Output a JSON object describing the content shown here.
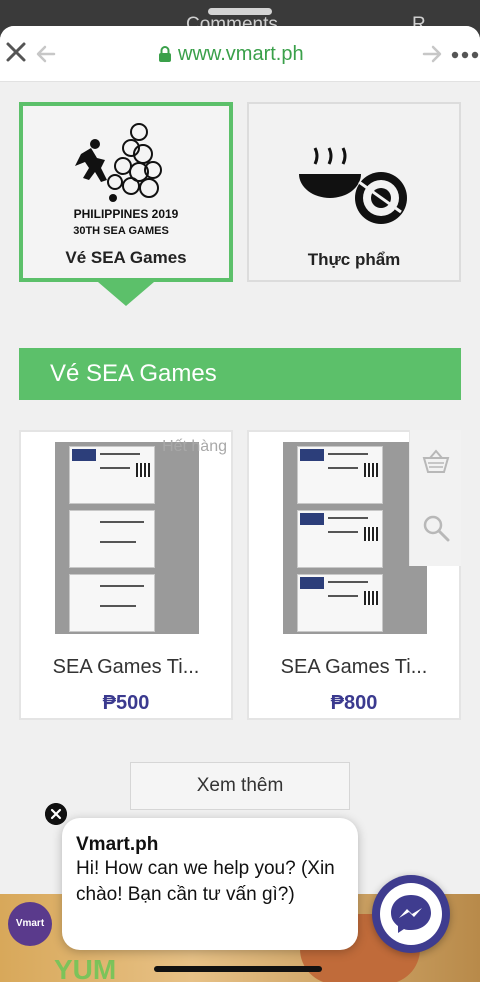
{
  "behind_sheet": {
    "peek_left": "Comments",
    "peek_right": "R"
  },
  "browser": {
    "url": "www.vmart.ph"
  },
  "categories": [
    {
      "label": "Vé SEA Games",
      "logo_text_1": "PHILIPPINES 2019",
      "logo_text_2": "30TH SEA GAMES"
    },
    {
      "label": "Thực phẩm"
    }
  ],
  "section": {
    "title": "Vé SEA Games"
  },
  "products": [
    {
      "title": "SEA Games Ti...",
      "price": "₱500",
      "badge": "Hết hàng"
    },
    {
      "title": "SEA Games Ti...",
      "price": "₱800"
    }
  ],
  "more_button": {
    "label": "Xem thêm"
  },
  "chat": {
    "sender": "Vmart.ph",
    "message": "Hi! How can we help you? (Xin chào! Bạn cần tư vấn gì?)"
  },
  "footer": {
    "logo_text": "Vmart",
    "banner_text": "YUM"
  },
  "colors": {
    "accent_green": "#5cc06a",
    "price_purple": "#3b3a8f",
    "url_green": "#3aa04a",
    "messenger": "#3f3c8f"
  },
  "icons": [
    "close-icon",
    "back-arrow-icon",
    "forward-arrow-icon",
    "more-icon",
    "lock-icon",
    "basket-icon",
    "search-icon",
    "messenger-icon"
  ]
}
